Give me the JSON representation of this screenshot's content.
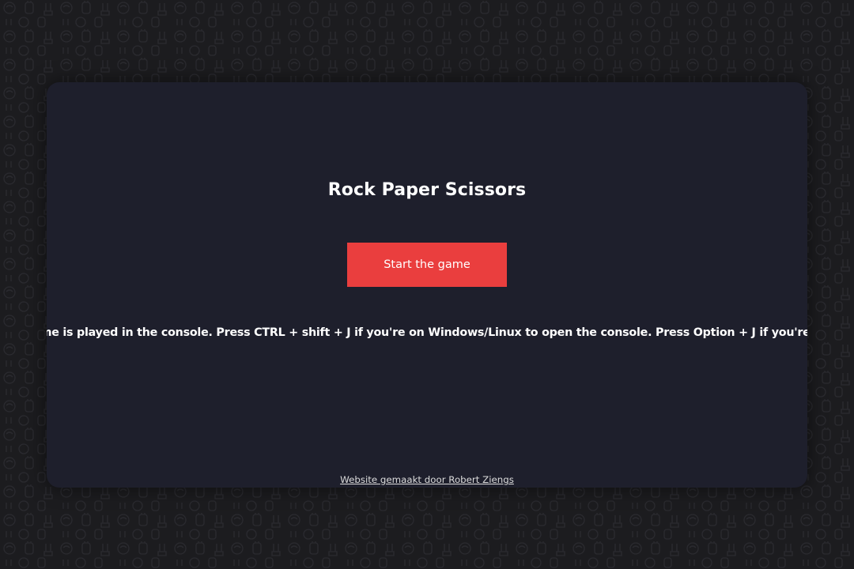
{
  "page": {
    "title": "Rock Paper Scissors",
    "start_button_label": "Start the game",
    "console_note": "This game is played in the console. Press CTRL + shift + J if you're on Windows/Linux to open the console. Press Option + J if you're on mac",
    "credit_link": "Website gemaakt door Robert Ziengs"
  },
  "colors": {
    "background": "#1c1c1f",
    "card": "#1e1f2c",
    "button": "#ea3e3e",
    "text": "#ffffff"
  },
  "icons": [
    "rock-hand-icon",
    "paper-hand-icon",
    "scissors-hand-icon"
  ]
}
